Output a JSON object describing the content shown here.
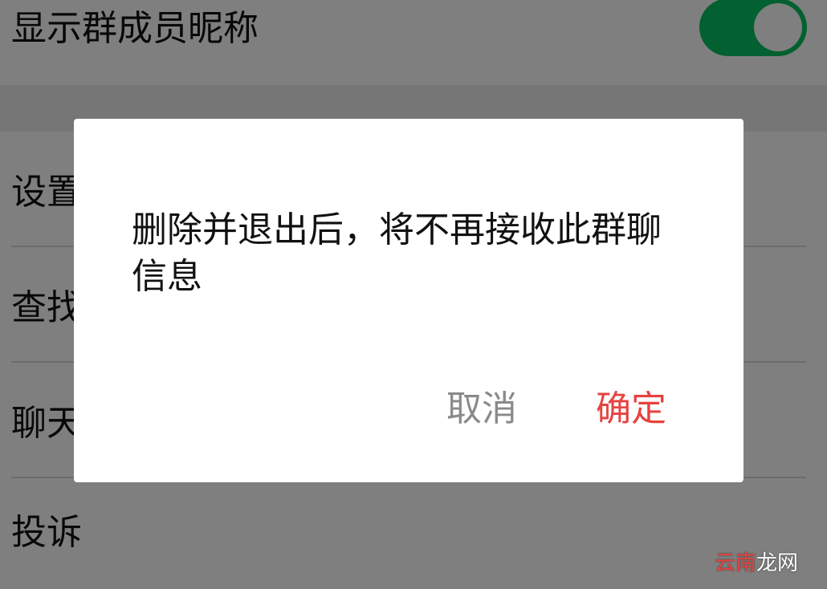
{
  "settings": {
    "show_member_nickname": {
      "label": "显示群成员昵称",
      "enabled": true
    },
    "rows": [
      {
        "id": "set",
        "label": "设置"
      },
      {
        "id": "find",
        "label": "查找"
      },
      {
        "id": "chat",
        "label": "聊天"
      },
      {
        "id": "report",
        "label": "投诉"
      }
    ]
  },
  "dialog": {
    "message": "删除并退出后，将不再接收此群聊信息",
    "cancel_label": "取消",
    "confirm_label": "确定"
  },
  "watermark": {
    "part1": "云南",
    "part2": "龙网"
  },
  "colors": {
    "toggle_on": "#07c160",
    "confirm": "#e64340",
    "cancel": "#8a8a8a",
    "overlay": "rgba(0,0,0,0.5)"
  }
}
